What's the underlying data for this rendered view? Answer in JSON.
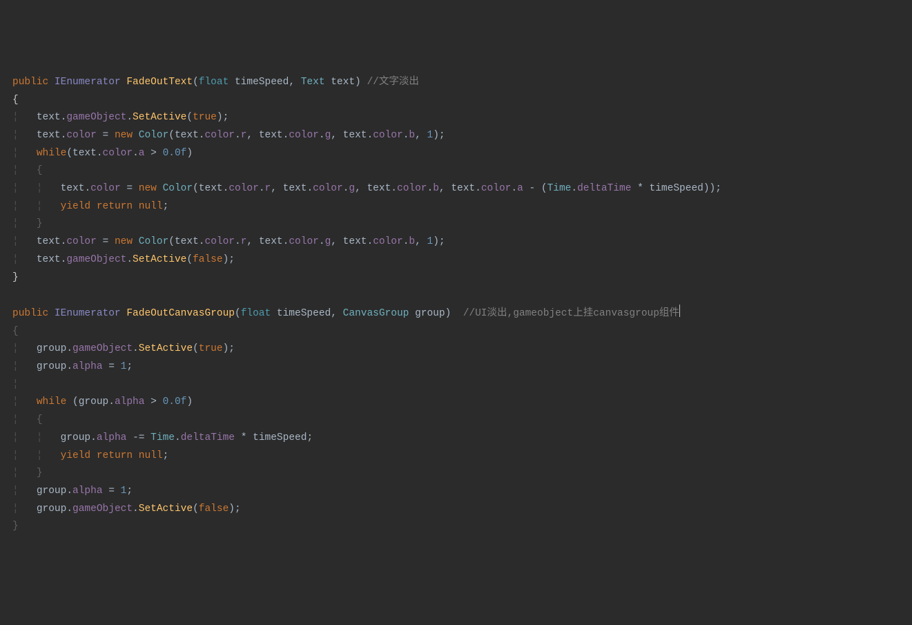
{
  "code": {
    "line1": {
      "kw_public": "public",
      "type_ienum": "IEnumerator",
      "method_name": "FadeOutText",
      "kw_float": "float",
      "param1": "timeSpeed",
      "cls_text": "Text",
      "param2": "text",
      "comment": "//文字淡出"
    },
    "line3": {
      "var": "text",
      "prop_go": "gameObject",
      "method_sa": "SetActive",
      "kw_true": "true"
    },
    "line4": {
      "var": "text",
      "prop_color": "color",
      "kw_new": "new",
      "cls_color": "Color",
      "prop_r": "r",
      "prop_g": "g",
      "prop_b": "b",
      "num_1": "1"
    },
    "line5": {
      "kw_while": "while",
      "var": "text",
      "prop_color": "color",
      "prop_a": "a",
      "num_0": "0.0f"
    },
    "line7": {
      "var": "text",
      "prop_color": "color",
      "kw_new": "new",
      "cls_color": "Color",
      "prop_r": "r",
      "prop_g": "g",
      "prop_b": "b",
      "prop_a": "a",
      "cls_time": "Time",
      "prop_dt": "deltaTime",
      "var_ts": "timeSpeed"
    },
    "line8": {
      "kw_yield": "yield",
      "kw_return": "return",
      "kw_null": "null"
    },
    "line10": {
      "var": "text",
      "prop_color": "color",
      "kw_new": "new",
      "cls_color": "Color",
      "prop_r": "r",
      "prop_g": "g",
      "prop_b": "b",
      "num_1": "1"
    },
    "line11": {
      "var": "text",
      "prop_go": "gameObject",
      "method_sa": "SetActive",
      "kw_false": "false"
    },
    "line14": {
      "kw_public": "public",
      "type_ienum": "IEnumerator",
      "method_name": "FadeOutCanvasGroup",
      "kw_float": "float",
      "param1": "timeSpeed",
      "cls_cg": "CanvasGroup",
      "param2": "group",
      "comment": "//UI淡出,gameobject上挂canvasgroup组件"
    },
    "line16": {
      "var": "group",
      "prop_go": "gameObject",
      "method_sa": "SetActive",
      "kw_true": "true"
    },
    "line17": {
      "var": "group",
      "prop_alpha": "alpha",
      "num_1": "1"
    },
    "line19": {
      "kw_while": "while",
      "var": "group",
      "prop_alpha": "alpha",
      "num_0": "0.0f"
    },
    "line21": {
      "var": "group",
      "prop_alpha": "alpha",
      "cls_time": "Time",
      "prop_dt": "deltaTime",
      "var_ts": "timeSpeed"
    },
    "line22": {
      "kw_yield": "yield",
      "kw_return": "return",
      "kw_null": "null"
    },
    "line24": {
      "var": "group",
      "prop_alpha": "alpha",
      "num_1": "1"
    },
    "line25": {
      "var": "group",
      "prop_go": "gameObject",
      "method_sa": "SetActive",
      "kw_false": "false"
    }
  }
}
